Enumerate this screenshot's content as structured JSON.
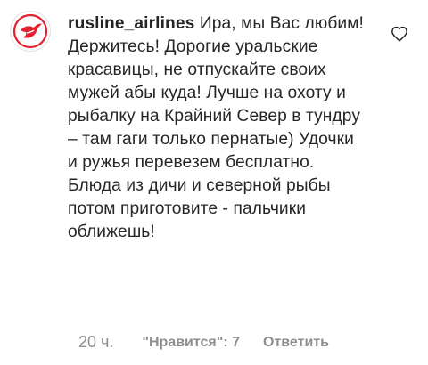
{
  "comment": {
    "avatar_icon": "airline-bird-logo-icon",
    "brand_color": "#e4202f",
    "username": "rusline_airlines",
    "text": "Ира, мы Вас любим! Держитесь! Дорогие уральские красавицы, не отпускайте своих мужей абы куда! Лучше на охоту и рыбалку на Крайний Север в тундру – там гаги только пернатые) Удочки и ружья перевезем бесплатно. Блюда из дичи и северной рыбы потом приготовите - пальчики оближешь!",
    "like_icon": "heart-outline-icon"
  },
  "meta": {
    "time": "20 ч.",
    "likes": "\"Нравится\": 7",
    "reply": "Ответить"
  }
}
